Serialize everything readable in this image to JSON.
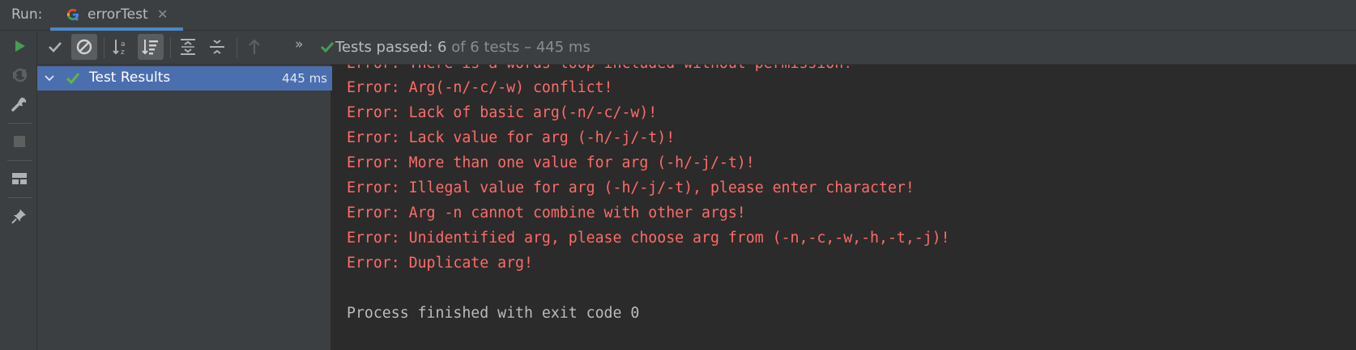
{
  "top": {
    "run_label": "Run:",
    "tab": {
      "title": "errorTest",
      "icon": "google-g-icon",
      "close": "✕"
    }
  },
  "toolbar": {
    "status_passed": "Tests passed: 6",
    "status_rest": " of 6 tests – 445 ms",
    "overflow": "»"
  },
  "tree": {
    "root_label": "Test Results",
    "root_time": "445 ms"
  },
  "console": {
    "lines": [
      "Error: There is a words loop included without permission!",
      "Error: Arg(-n/-c/-w) conflict!",
      "Error: Lack of basic arg(-n/-c/-w)!",
      "Error: Lack value for arg (-h/-j/-t)!",
      "Error: More than one value for arg (-h/-j/-t)!",
      "Error: Illegal value for arg (-h/-j/-t), please enter character!",
      "Error: Arg -n cannot combine with other args!",
      "Error: Unidentified arg, please choose arg from (-n,-c,-w,-h,-t,-j)!",
      "Error: Duplicate arg!"
    ],
    "exit_line": "Process finished with exit code 0"
  },
  "colors": {
    "error_text": "#ff6b68",
    "pass_green": "#499c54",
    "selection": "#4b6eaf",
    "tab_underline": "#4a88c7"
  }
}
